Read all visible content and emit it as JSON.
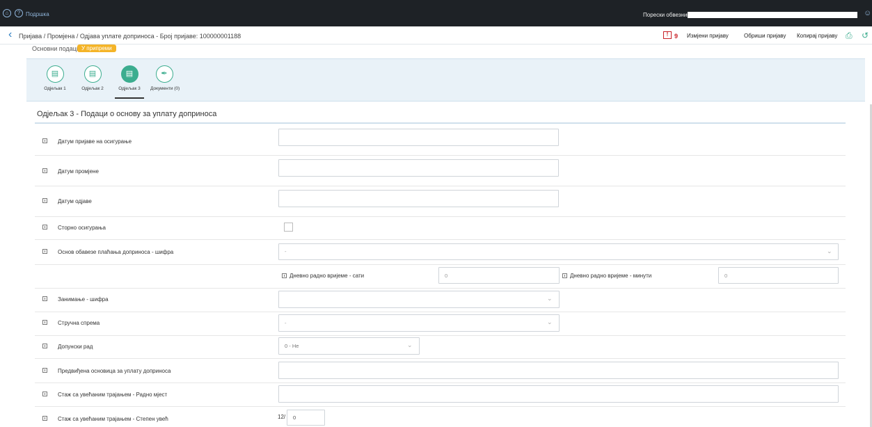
{
  "topbar": {
    "home_icon": "home-icon",
    "help_icon": "question-circle-icon",
    "help_label": "Подршка",
    "taxpayer_label": "Порески обвезник",
    "user_icon": "user-icon"
  },
  "subbar": {
    "back_icon": "chevron-left-icon",
    "breadcrumb": "Пријава / Промјена / Одјава уплате доприноса - Број пријаве: 100000001188",
    "warning_count": "9",
    "actions": {
      "edit": "Измјени пријаву",
      "delete": "Обриши пријаву",
      "copy": "Копирај пријаву"
    },
    "print_icon": "print-icon",
    "export_icon": "export-icon"
  },
  "basic": {
    "label": "Основни подаци",
    "status": "У припреми"
  },
  "tabs": [
    {
      "label": "Одјељак 1",
      "icon": "document-icon"
    },
    {
      "label": "Одјељак 2",
      "icon": "document-icon"
    },
    {
      "label": "Одјељак 3",
      "icon": "document-icon"
    },
    {
      "label": "Документи (0)",
      "icon": "paperclip-icon"
    }
  ],
  "section": {
    "title": "Одјељак 3 - Подаци о основу за уплату доприноса"
  },
  "fields": {
    "insurance_date": {
      "label": "Датум пријаве на осигурање",
      "value": ""
    },
    "change_date": {
      "label": "Датум промјене",
      "value": ""
    },
    "deregistration_date": {
      "label": "Датум одјаве",
      "value": ""
    },
    "storno": {
      "label": "Сторно осигурања",
      "checked": false
    },
    "obligation_basis": {
      "label": "Основ обавезе плаћања доприноса - шифра",
      "value": "-"
    },
    "hours": {
      "label": "Дневно радно вријеме - сати",
      "value": "0"
    },
    "minutes": {
      "label": "Дневно радно вријеме - минути",
      "value": "0"
    },
    "occupation": {
      "label": "Занимање - шифра",
      "value": ""
    },
    "qualification": {
      "label": "Стручна спрема",
      "value": "-"
    },
    "additional_work": {
      "label": "Допунски рад",
      "value": "0 - Не"
    },
    "projected_base": {
      "label": "Предвиђена основица за уплату доприноса",
      "value": ""
    },
    "extended_service_place": {
      "label": "Стаж са увећаним трајањем - Радно мјест",
      "value": ""
    },
    "extended_service_degree": {
      "label": "Стаж са увећаним трајањем - Степен увећ",
      "prefix": "12/",
      "value": "0"
    }
  }
}
